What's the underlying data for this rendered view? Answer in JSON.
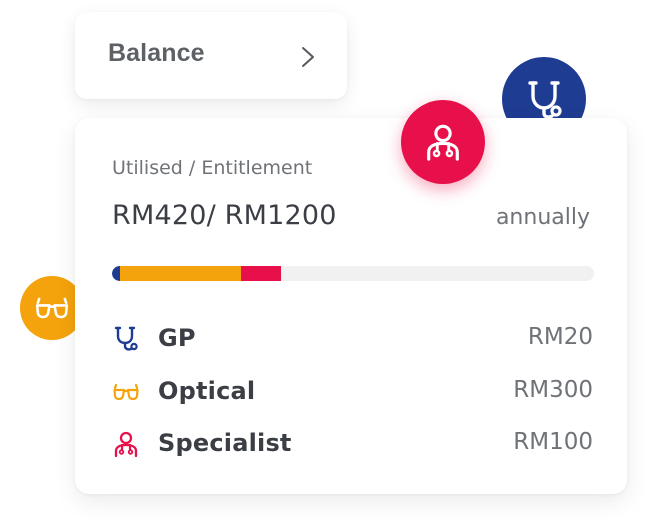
{
  "balance": {
    "title": "Balance",
    "chevron_icon": "chevron-right-icon"
  },
  "summary": {
    "label": "Utilised / Entitlement",
    "amount": "RM420/ RM1200",
    "period": "annually",
    "progress": {
      "total": 1200,
      "segments": [
        {
          "name": "GP",
          "value": 20,
          "color": "#1f3c93"
        },
        {
          "name": "Optical",
          "value": 300,
          "color": "#f4a30c"
        },
        {
          "name": "Specialist",
          "value": 100,
          "color": "#e8104a"
        }
      ]
    }
  },
  "items": [
    {
      "label": "GP",
      "amount": "RM20",
      "icon": "stethoscope-icon",
      "color": "#1f3c93"
    },
    {
      "label": "Optical",
      "amount": "RM300",
      "icon": "glasses-icon",
      "color": "#f4a30c"
    },
    {
      "label": "Specialist",
      "amount": "RM100",
      "icon": "doctor-icon",
      "color": "#e8104a"
    }
  ],
  "floating_badges": [
    {
      "icon": "stethoscope-icon",
      "color": "#1f3c93"
    },
    {
      "icon": "doctor-icon",
      "color": "#e8104a"
    },
    {
      "icon": "glasses-icon",
      "color": "#f4a30c"
    }
  ]
}
